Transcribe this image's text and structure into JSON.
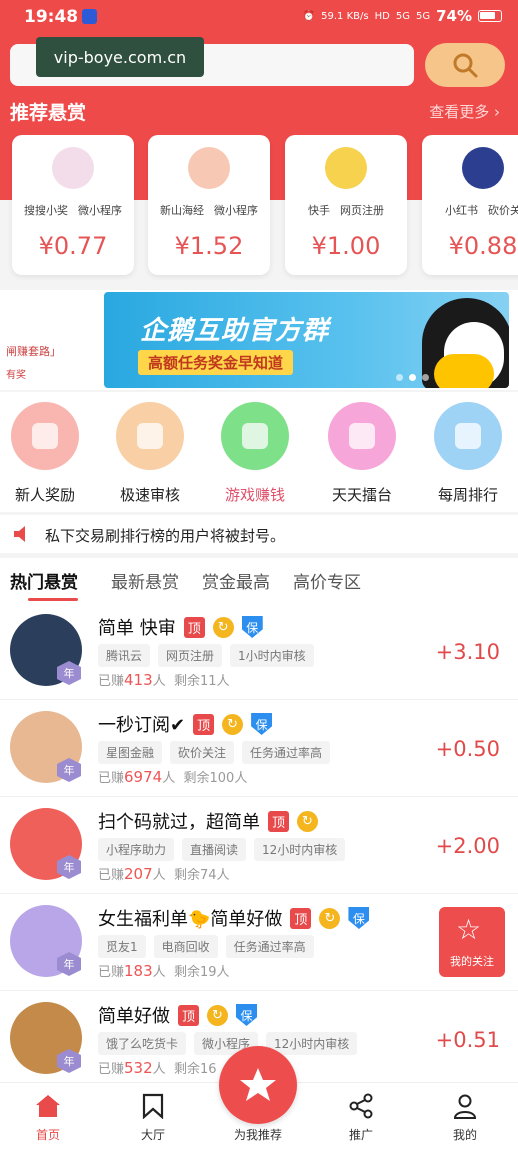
{
  "status": {
    "time": "19:48",
    "net_speed": "59.1 KB/s",
    "hd": "HD",
    "signal1": "5G",
    "signal2": "5G",
    "battery": "74%"
  },
  "watermark": "vip-boye.com.cn",
  "search": {
    "placeholder": ""
  },
  "recommend": {
    "title": "推荐悬赏",
    "more": "查看更多 ›"
  },
  "bounties": [
    {
      "tag1": "搜搜小奖",
      "tag2": "微小程序",
      "price": "¥0.77",
      "avatar_color": "#f3ddea"
    },
    {
      "tag1": "新山海经",
      "tag2": "微小程序",
      "price": "¥1.52",
      "avatar_color": "#f7c9b4"
    },
    {
      "tag1": "快手",
      "tag2": "网页注册",
      "price": "¥1.00",
      "avatar_color": "#f6d24e"
    },
    {
      "tag1": "小红书",
      "tag2": "砍价关",
      "price": "¥0.88",
      "avatar_color": "#2c3e8f"
    }
  ],
  "banner": {
    "left_text1": "闸赚套路」",
    "left_text2": "有奖",
    "title": "企鹅互助官方群",
    "subtitle": "高额任务奖金早知道"
  },
  "quick_actions": [
    {
      "label": "新人奖励",
      "color": "#f9b5b0",
      "icon": "gift-icon"
    },
    {
      "label": "极速审核",
      "color": "#f9cfa6",
      "icon": "fast-review-icon"
    },
    {
      "label": "游戏赚钱",
      "color": "#7fe08a",
      "icon": "gamepad-icon"
    },
    {
      "label": "天天擂台",
      "color": "#f6a6d8",
      "icon": "arena-icon"
    },
    {
      "label": "每周排行",
      "color": "#9fd3f6",
      "icon": "ranking-icon"
    }
  ],
  "notice": "私下交易刷排行榜的用户将被封号。",
  "tabs": [
    "热门悬赏",
    "最新悬赏",
    "赏金最高",
    "高价专区"
  ],
  "badges": {
    "top": "顶",
    "circle": "↻",
    "shield": "保",
    "year": "年"
  },
  "tasks": [
    {
      "title": "简单 快审",
      "shield": true,
      "tags": [
        "腾讯云",
        "网页注册",
        "1小时内审核"
      ],
      "earned_label": "已赚",
      "earned": "413",
      "earned_unit": "人",
      "remain_label": "剩余",
      "remain": "11",
      "remain_unit": "人",
      "reward": "+3.10",
      "avatar_color": "#2b3f5c"
    },
    {
      "title": "一秒订阅✔",
      "shield": true,
      "tags": [
        "星图金融",
        "砍价关注",
        "任务通过率高"
      ],
      "earned_label": "已赚",
      "earned": "6974",
      "earned_unit": "人",
      "remain_label": "剩余",
      "remain": "100",
      "remain_unit": "人",
      "reward": "+0.50",
      "avatar_color": "#e7b892"
    },
    {
      "title": "扫个码就过，超简单",
      "shield": false,
      "tags": [
        "小程序助力",
        "直播阅读",
        "12小时内审核"
      ],
      "earned_label": "已赚",
      "earned": "207",
      "earned_unit": "人",
      "remain_label": "剩余",
      "remain": "74",
      "remain_unit": "人",
      "reward": "+2.00",
      "avatar_color": "#f0605a"
    },
    {
      "title": "女生福利单🐤简单好做",
      "shield": true,
      "tags": [
        "觅友1",
        "电商回收",
        "任务通过率高"
      ],
      "earned_label": "已赚",
      "earned": "183",
      "earned_unit": "人",
      "remain_label": "剩余",
      "remain": "19",
      "remain_unit": "人",
      "reward": "",
      "avatar_color": "#b9a6e8"
    },
    {
      "title": "简单好做",
      "shield": true,
      "tags": [
        "饿了么吃货卡",
        "微小程序",
        "12小时内审核"
      ],
      "earned_label": "已赚",
      "earned": "532",
      "earned_unit": "人",
      "remain_label": "剩余",
      "remain": "16",
      "remain_unit": "",
      "reward": "+0.51",
      "avatar_color": "#c48a4a"
    }
  ],
  "fav": {
    "label": "我的关注"
  },
  "nav": [
    {
      "label": "首页",
      "icon": "home-icon",
      "active": true
    },
    {
      "label": "大厅",
      "icon": "hall-icon",
      "active": false
    },
    {
      "label": "为我推荐",
      "icon": "star-fab-icon",
      "active": false
    },
    {
      "label": "推广",
      "icon": "share-icon",
      "active": false
    },
    {
      "label": "我的",
      "icon": "user-icon",
      "active": false
    }
  ]
}
